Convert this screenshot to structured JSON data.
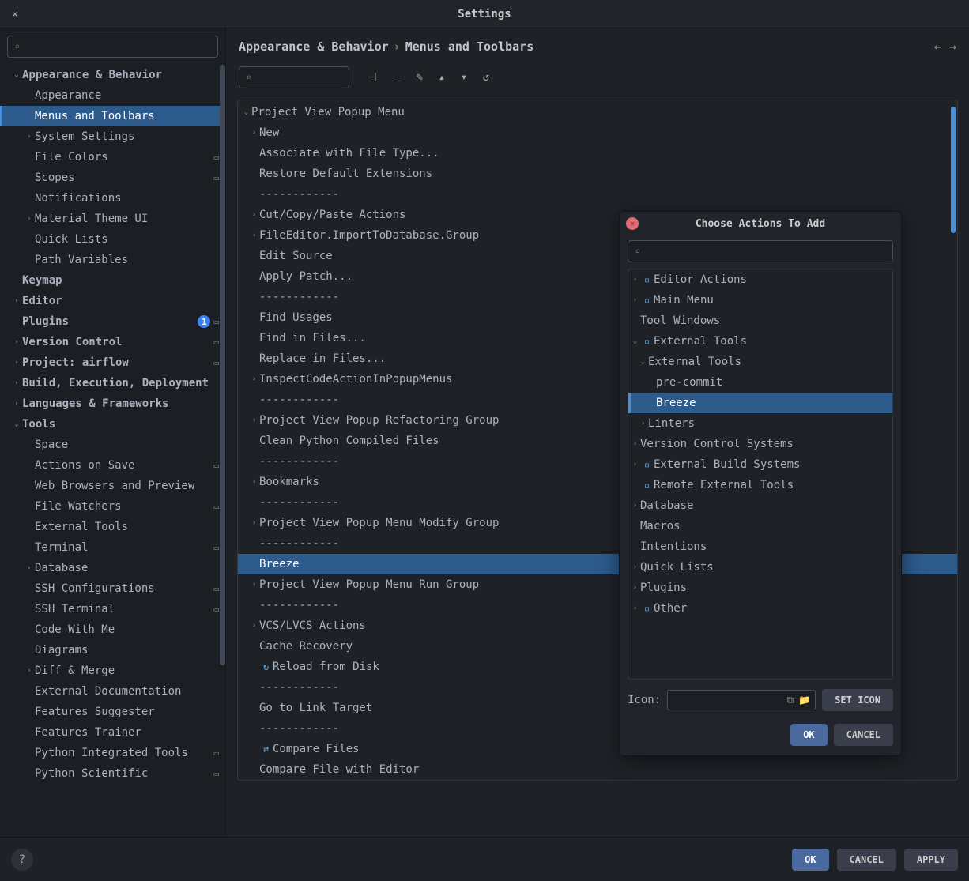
{
  "window_title": "Settings",
  "breadcrumb": {
    "section": "Appearance & Behavior",
    "page": "Menus and Toolbars",
    "sep": "›"
  },
  "sidebar": {
    "items": [
      {
        "label": "Appearance & Behavior",
        "depth": 0,
        "bold": true,
        "chev": "down"
      },
      {
        "label": "Appearance",
        "depth": 1
      },
      {
        "label": "Menus and Toolbars",
        "depth": 1,
        "selected": true
      },
      {
        "label": "System Settings",
        "depth": 1,
        "chev": "right"
      },
      {
        "label": "File Colors",
        "depth": 1,
        "mod": true
      },
      {
        "label": "Scopes",
        "depth": 1,
        "mod": true
      },
      {
        "label": "Notifications",
        "depth": 1
      },
      {
        "label": "Material Theme UI",
        "depth": 1,
        "chev": "right"
      },
      {
        "label": "Quick Lists",
        "depth": 1
      },
      {
        "label": "Path Variables",
        "depth": 1
      },
      {
        "label": "Keymap",
        "depth": 0,
        "bold": true
      },
      {
        "label": "Editor",
        "depth": 0,
        "bold": true,
        "chev": "right"
      },
      {
        "label": "Plugins",
        "depth": 0,
        "bold": true,
        "badge": "1",
        "mod": true
      },
      {
        "label": "Version Control",
        "depth": 0,
        "bold": true,
        "chev": "right",
        "mod": true
      },
      {
        "label": "Project: airflow",
        "depth": 0,
        "bold": true,
        "chev": "right",
        "mod": true
      },
      {
        "label": "Build, Execution, Deployment",
        "depth": 0,
        "bold": true,
        "chev": "right"
      },
      {
        "label": "Languages & Frameworks",
        "depth": 0,
        "bold": true,
        "chev": "right"
      },
      {
        "label": "Tools",
        "depth": 0,
        "bold": true,
        "chev": "down"
      },
      {
        "label": "Space",
        "depth": 1
      },
      {
        "label": "Actions on Save",
        "depth": 1,
        "mod": true
      },
      {
        "label": "Web Browsers and Preview",
        "depth": 1
      },
      {
        "label": "File Watchers",
        "depth": 1,
        "mod": true
      },
      {
        "label": "External Tools",
        "depth": 1
      },
      {
        "label": "Terminal",
        "depth": 1,
        "mod": true
      },
      {
        "label": "Database",
        "depth": 1,
        "chev": "right"
      },
      {
        "label": "SSH Configurations",
        "depth": 1,
        "mod": true
      },
      {
        "label": "SSH Terminal",
        "depth": 1,
        "mod": true
      },
      {
        "label": "Code With Me",
        "depth": 1
      },
      {
        "label": "Diagrams",
        "depth": 1
      },
      {
        "label": "Diff & Merge",
        "depth": 1,
        "chev": "right"
      },
      {
        "label": "External Documentation",
        "depth": 1
      },
      {
        "label": "Features Suggester",
        "depth": 1
      },
      {
        "label": "Features Trainer",
        "depth": 1
      },
      {
        "label": "Python Integrated Tools",
        "depth": 1,
        "mod": true
      },
      {
        "label": "Python Scientific",
        "depth": 1,
        "mod": true
      }
    ]
  },
  "separator": "------------",
  "menu_tree": [
    {
      "label": "Project View Popup Menu",
      "depth": 0,
      "chev": "down"
    },
    {
      "label": "New",
      "depth": 1,
      "chev": "right"
    },
    {
      "label": "Associate with File Type...",
      "depth": 1
    },
    {
      "label": "Restore Default Extensions",
      "depth": 1
    },
    {
      "sep": true,
      "depth": 1
    },
    {
      "label": "Cut/Copy/Paste Actions",
      "depth": 1,
      "chev": "right"
    },
    {
      "label": "FileEditor.ImportToDatabase.Group",
      "depth": 1,
      "chev": "right"
    },
    {
      "label": "Edit Source",
      "depth": 1
    },
    {
      "label": "Apply Patch...",
      "depth": 1
    },
    {
      "sep": true,
      "depth": 1
    },
    {
      "label": "Find Usages",
      "depth": 1
    },
    {
      "label": "Find in Files...",
      "depth": 1
    },
    {
      "label": "Replace in Files...",
      "depth": 1
    },
    {
      "label": "InspectCodeActionInPopupMenus",
      "depth": 1,
      "chev": "right"
    },
    {
      "sep": true,
      "depth": 1
    },
    {
      "label": "Project View Popup Refactoring Group",
      "depth": 1,
      "chev": "right"
    },
    {
      "label": "Clean Python Compiled Files",
      "depth": 1
    },
    {
      "sep": true,
      "depth": 1
    },
    {
      "label": "Bookmarks",
      "depth": 1,
      "chev": "right"
    },
    {
      "sep": true,
      "depth": 1
    },
    {
      "label": "Project View Popup Menu Modify Group",
      "depth": 1,
      "chev": "right"
    },
    {
      "sep": true,
      "depth": 1
    },
    {
      "label": "Breeze",
      "depth": 1,
      "selected": true
    },
    {
      "label": "Project View Popup Menu Run Group",
      "depth": 1,
      "chev": "right"
    },
    {
      "sep": true,
      "depth": 1
    },
    {
      "label": "VCS/LVCS Actions",
      "depth": 1,
      "chev": "right"
    },
    {
      "label": "Cache Recovery",
      "depth": 1
    },
    {
      "label": "Reload from Disk",
      "depth": 1,
      "icon": "reload"
    },
    {
      "sep": true,
      "depth": 1
    },
    {
      "label": "Go to Link Target",
      "depth": 1
    },
    {
      "sep": true,
      "depth": 1
    },
    {
      "label": "Compare Files",
      "depth": 1,
      "icon": "compare"
    },
    {
      "label": "Compare File with Editor",
      "depth": 1
    }
  ],
  "modal": {
    "title": "Choose Actions To Add",
    "tree": [
      {
        "label": "Editor Actions",
        "depth": 0,
        "chev": "right",
        "icon": "folder"
      },
      {
        "label": "Main Menu",
        "depth": 0,
        "chev": "right",
        "icon": "folder"
      },
      {
        "label": "Tool Windows",
        "depth": 0
      },
      {
        "label": "External Tools",
        "depth": 0,
        "chev": "down",
        "icon": "folder"
      },
      {
        "label": "External Tools",
        "depth": 1,
        "chev": "down"
      },
      {
        "label": "pre-commit",
        "depth": 2
      },
      {
        "label": "Breeze",
        "depth": 2,
        "selected": true
      },
      {
        "label": "Linters",
        "depth": 1,
        "chev": "right"
      },
      {
        "label": "Version Control Systems",
        "depth": 0,
        "chev": "right"
      },
      {
        "label": "External Build Systems",
        "depth": 0,
        "chev": "right",
        "icon": "folder"
      },
      {
        "label": "Remote External Tools",
        "depth": 0,
        "icon": "folder"
      },
      {
        "label": "Database",
        "depth": 0,
        "chev": "right"
      },
      {
        "label": "Macros",
        "depth": 0
      },
      {
        "label": "Intentions",
        "depth": 0
      },
      {
        "label": "Quick Lists",
        "depth": 0,
        "chev": "right"
      },
      {
        "label": "Plugins",
        "depth": 0,
        "chev": "right"
      },
      {
        "label": "Other",
        "depth": 0,
        "chev": "right",
        "icon": "folder"
      }
    ],
    "icon_label": "Icon:",
    "set_icon": "SET ICON",
    "ok": "OK",
    "cancel": "CANCEL"
  },
  "footer": {
    "ok": "OK",
    "cancel": "CANCEL",
    "apply": "APPLY",
    "help": "?"
  }
}
